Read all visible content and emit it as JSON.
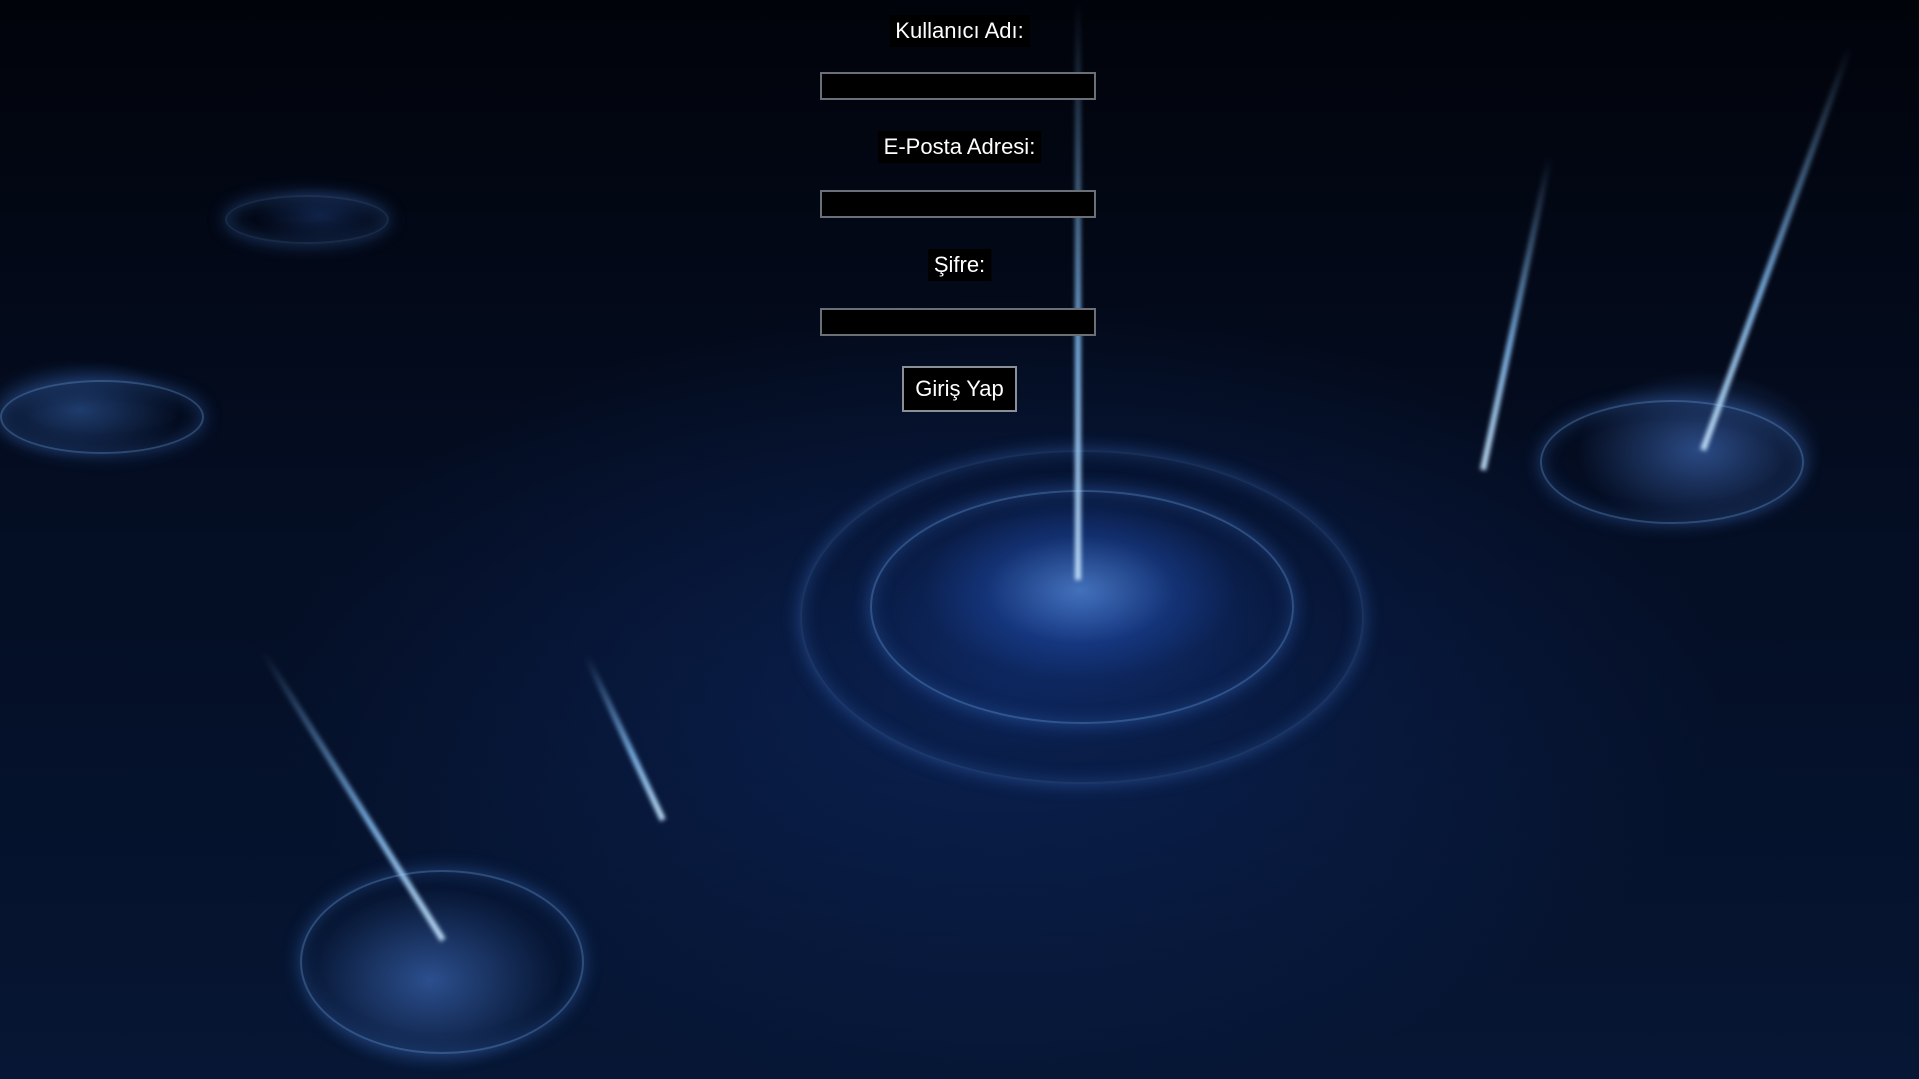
{
  "login_form": {
    "username_label": "Kullanıcı Adı:",
    "username_value": "",
    "email_label": "E-Posta Adresi:",
    "email_value": "",
    "password_label": "Şifre:",
    "password_value": "",
    "submit_label": "Giriş Yap"
  },
  "background": {
    "description_icon": "blue-fractal-wallpaper",
    "accent_color": "#3a7bff"
  }
}
